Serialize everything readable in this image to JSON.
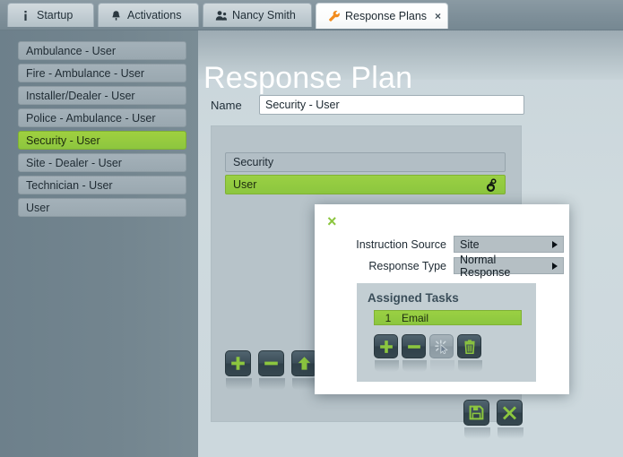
{
  "tabs": [
    {
      "label": "Startup",
      "icon": "info-icon",
      "active": false,
      "closable": false
    },
    {
      "label": "Activations",
      "icon": "alarm-bell-icon",
      "active": false,
      "closable": false
    },
    {
      "label": "Nancy Smith",
      "icon": "user-group-icon",
      "active": false,
      "closable": false
    },
    {
      "label": "Response Plans",
      "icon": "wrench-icon",
      "active": true,
      "closable": true,
      "close_label": "×"
    }
  ],
  "sidebar": {
    "items": [
      {
        "label": "Ambulance - User",
        "selected": false
      },
      {
        "label": "Fire - Ambulance - User",
        "selected": false
      },
      {
        "label": "Installer/Dealer - User",
        "selected": false
      },
      {
        "label": "Police - Ambulance - User",
        "selected": false
      },
      {
        "label": "Security - User",
        "selected": true
      },
      {
        "label": "Site - Dealer - User",
        "selected": false
      },
      {
        "label": "Technician - User",
        "selected": false
      },
      {
        "label": "User",
        "selected": false
      }
    ]
  },
  "main": {
    "title": "Response Plan",
    "name_label": "Name",
    "name_value": "Security - User",
    "plan_rows": [
      {
        "label": "Security",
        "selected": false,
        "icon": null
      },
      {
        "label": "User",
        "selected": true,
        "icon": "person-key-icon"
      }
    ],
    "toolbar": [
      {
        "name": "add-plan-row-button",
        "icon": "plus-icon",
        "disabled": false
      },
      {
        "name": "remove-plan-row-button",
        "icon": "minus-icon",
        "disabled": false
      },
      {
        "name": "move-up-plan-row-button",
        "icon": "up-arrow-icon",
        "disabled": false
      },
      {
        "name": "move-down-plan-row-button",
        "icon": "down-arrow-icon",
        "disabled": false
      }
    ],
    "actions": [
      {
        "name": "save-button",
        "icon": "save-disk-icon"
      },
      {
        "name": "cancel-button",
        "icon": "close-x-icon"
      }
    ]
  },
  "popup": {
    "close_label": "×",
    "fields": [
      {
        "label": "Instruction Source",
        "value": "Site"
      },
      {
        "label": "Response Type",
        "value": "Normal Response"
      }
    ],
    "tasks": {
      "title": "Assigned Tasks",
      "rows": [
        {
          "number": "1",
          "name": "Email",
          "selected": true
        }
      ],
      "toolbar": [
        {
          "name": "add-task-button",
          "icon": "plus-icon",
          "disabled": false
        },
        {
          "name": "remove-task-button",
          "icon": "minus-icon",
          "disabled": false
        },
        {
          "name": "select-task-button",
          "icon": "cursor-sparkle-icon",
          "disabled": true
        },
        {
          "name": "delete-task-button",
          "icon": "trash-icon",
          "disabled": false
        }
      ]
    }
  },
  "colors": {
    "accent_green": "#8cc63f",
    "tab_icon_orange": "#f28c1e",
    "sidebar_bg": "#73858f",
    "content_bg": "#ccd8dd",
    "panel_bg": "#b7c3c9",
    "button_dark": "#3c4e59"
  }
}
